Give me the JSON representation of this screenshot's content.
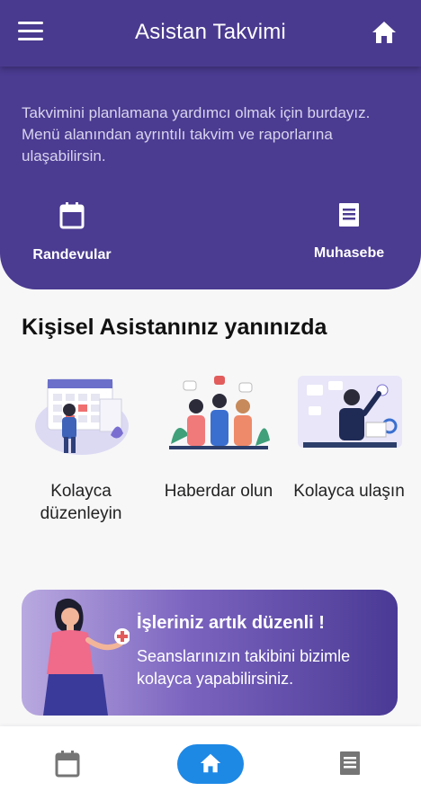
{
  "appbar": {
    "title": "Asistan Takvimi",
    "menu_icon": "hamburger-menu-icon",
    "home_icon": "home-icon"
  },
  "intro": {
    "text": "Takvimini planlamana yardımcı olmak için burdayız. Menü alanından ayrıntılı takvim ve raporlarına ulaşabilirsin."
  },
  "shortcuts": [
    {
      "label": "Randevular",
      "icon": "calendar-icon"
    },
    {
      "label": "Muhasebe",
      "icon": "document-icon"
    }
  ],
  "section": {
    "title": "Kişisel Asistanınız yanınızda"
  },
  "features": [
    {
      "caption": "Kolayca düzenleyin",
      "icon": "calendar-planning-illustration"
    },
    {
      "caption": "Haberdar olun",
      "icon": "team-illustration"
    },
    {
      "caption": "Kolayca ulaşın",
      "icon": "office-illustration"
    }
  ],
  "banner": {
    "title": "İşleriniz artık düzenli !",
    "text": "Seanslarınızın takibini bizimle kolayca yapabilirsiniz."
  },
  "bottom_nav": {
    "items": [
      "calendar-icon",
      "home-icon",
      "document-icon"
    ],
    "active": "home-icon"
  },
  "colors": {
    "primary": "#4b3b91",
    "accent": "#1e88e5",
    "background": "#f7f7f8"
  }
}
